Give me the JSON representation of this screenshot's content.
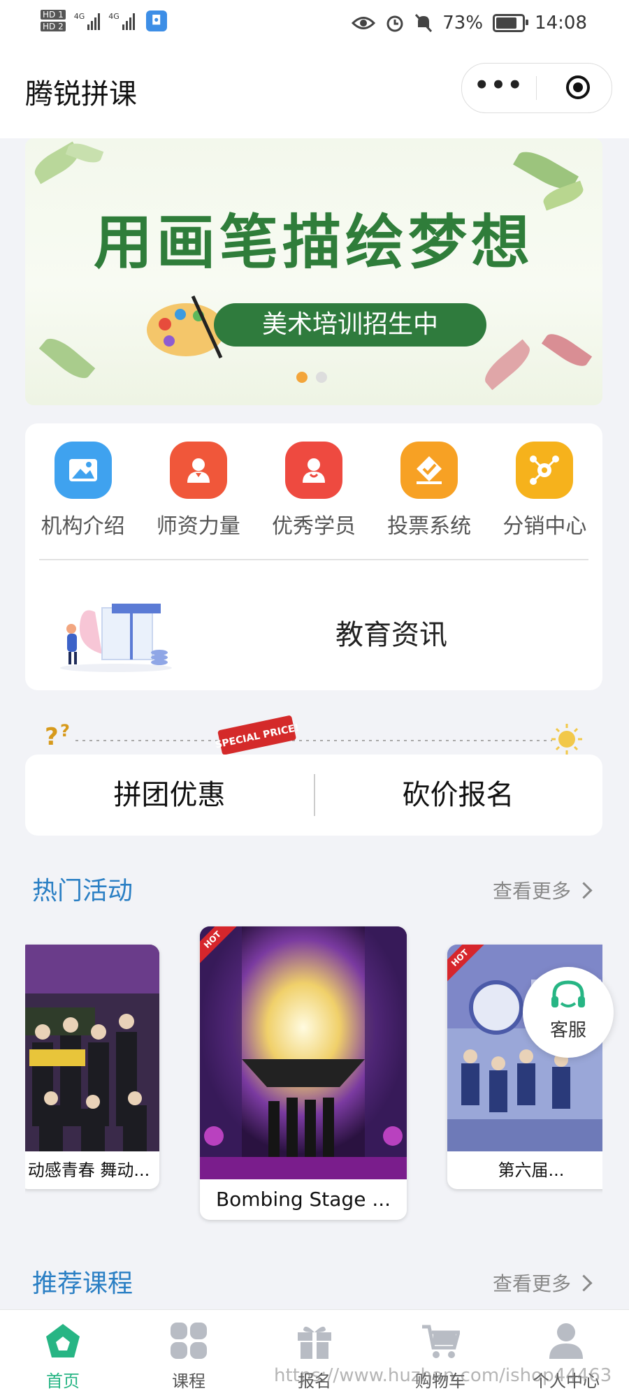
{
  "status_bar": {
    "hd1": "HD 1",
    "hd2": "HD 2",
    "net1": "4G",
    "net2": "4G",
    "battery": "73%",
    "time": "14:08"
  },
  "header": {
    "title": "腾锐拼课",
    "more_label": "•••"
  },
  "banner": {
    "title": "用画笔描绘梦想",
    "subtitle": "美术培训招生中",
    "slides": 2,
    "active_slide": 1
  },
  "menu": {
    "items": [
      {
        "label": "机构介绍",
        "icon": "image-icon",
        "color": "#3fa2ef"
      },
      {
        "label": "师资力量",
        "icon": "teacher-icon",
        "color": "#f0573a"
      },
      {
        "label": "优秀学员",
        "icon": "student-icon",
        "color": "#ee4a40"
      },
      {
        "label": "投票系统",
        "icon": "vote-icon",
        "color": "#f7a124"
      },
      {
        "label": "分销中心",
        "icon": "share-icon",
        "color": "#f6b21c"
      }
    ],
    "news_title": "教育资讯"
  },
  "deco": {
    "tag": "SPECIAL PRICE!"
  },
  "group": {
    "left": "拼团优惠",
    "right": "砍价报名"
  },
  "hot_activities": {
    "title": "热门活动",
    "more": "查看更多",
    "badge": "HOT",
    "cards": [
      {
        "caption": "动感青春 舞动..."
      },
      {
        "caption": "Bombing Stage ..."
      },
      {
        "caption": "第六届..."
      }
    ]
  },
  "service": {
    "label": "客服"
  },
  "recommend": {
    "title": "推荐课程",
    "more": "查看更多"
  },
  "tabbar": {
    "items": [
      {
        "label": "首页",
        "icon": "home-icon",
        "active": true
      },
      {
        "label": "课程",
        "icon": "grid-icon",
        "active": false
      },
      {
        "label": "报名",
        "icon": "gift-icon",
        "active": false
      },
      {
        "label": "购物车",
        "icon": "cart-icon",
        "active": false
      },
      {
        "label": "个人中心",
        "icon": "user-icon",
        "active": false
      }
    ]
  },
  "watermark": "https://www.huzhan.com/ishop44463"
}
